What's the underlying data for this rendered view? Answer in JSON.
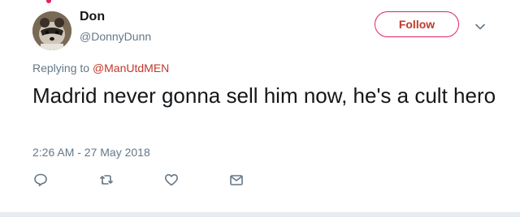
{
  "tweet": {
    "display_name": "Don",
    "username": "@DonnyDunn",
    "follow_label": "Follow",
    "reply_prefix": "Replying to ",
    "reply_mention": "@ManUtdMEN",
    "text": "Madrid never gonna sell him now, he's a cult hero",
    "timestamp": "2:26 AM - 27 May 2018"
  },
  "actions": [
    {
      "name": "reply",
      "icon": "reply-icon"
    },
    {
      "name": "retweet",
      "icon": "retweet-icon"
    },
    {
      "name": "like",
      "icon": "heart-icon"
    },
    {
      "name": "direct-message",
      "icon": "envelope-icon"
    }
  ],
  "colors": {
    "accent": "#e0245e",
    "link": "#c0392b",
    "secondary_text": "#657786",
    "primary_text": "#14171a",
    "icon": "#657786"
  }
}
